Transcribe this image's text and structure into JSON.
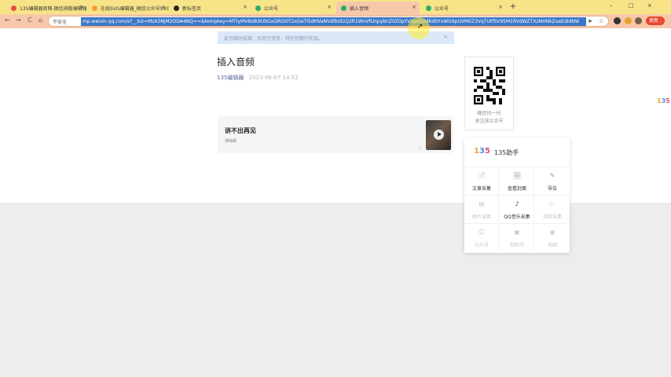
{
  "tabs": [
    {
      "title": "135编辑器官网-微信排版编辑器",
      "fav": "#e84b3c"
    },
    {
      "title": "在线SVG编辑器_微信公众号SVG",
      "fav": "#f0a030"
    },
    {
      "title": "新标签页",
      "fav": "#222222"
    },
    {
      "title": "公众号",
      "fav": "#2aae67"
    },
    {
      "title": "插入音频",
      "fav": "#2aae67"
    },
    {
      "title": "公众号",
      "fav": "#2aae67"
    }
  ],
  "tab_close": "×",
  "new_tab": "+",
  "window_controls": {
    "minimize": "–",
    "maximize": "□",
    "close": "×"
  },
  "nav": {
    "back": "←",
    "forward": "→",
    "reload": "C",
    "home": "⌂"
  },
  "address": {
    "security": "不安全",
    "url": "mp.weixin.qq.com/s?__biz=MzA3NjM2ODA4NQ==&tempkey=MTIyMV8idk9UbGxGRGl0T2xGeTI5dHVaNVdlbUtzQ2R1WnVfUnpybnZ0Z0pYVXpvSXdKd0YxWG9pUVM0Z3VqTUtfSV95M1RVdWZTXzNHNkZueEdIdkNl"
  },
  "update_label": "更新 :",
  "warning_bar": {
    "text": "此为临时链接，仅用于预览，将在短期内失效。",
    "close": "×"
  },
  "article": {
    "title": "插入音频",
    "author": "135编辑器",
    "date": "2023-06-07 14:52"
  },
  "audio": {
    "name": "讲不出再见",
    "source": "谭咏麟",
    "info": "ⓘ"
  },
  "qr": {
    "line1": "微信扫一扫",
    "line2": "关注该公众号"
  },
  "helper": {
    "logo": "135",
    "title": "135助手",
    "items": [
      {
        "icon": "📄",
        "label": "文章采集",
        "enabled": true
      },
      {
        "icon": "🖼",
        "label": "查看封面",
        "enabled": true
      },
      {
        "icon": "✎",
        "label": "导告",
        "enabled": true
      },
      {
        "icon": "▤",
        "label": "图片采集",
        "enabled": false
      },
      {
        "icon": "♪",
        "label": "QQ音乐采集",
        "enabled": true
      },
      {
        "icon": "▷",
        "label": "视频采集",
        "enabled": false
      },
      {
        "icon": "☺",
        "label": "公众号",
        "enabled": false
      },
      {
        "icon": "▣",
        "label": "视频号",
        "enabled": false
      },
      {
        "icon": "◉",
        "label": "地图",
        "enabled": false
      }
    ]
  },
  "side_badge": "135",
  "colors": {
    "tab_bar": "#f7e489",
    "active_tab": "#f6c8a9",
    "url_highlight": "#3c77c7",
    "link": "#576b95",
    "update": "#e9452f"
  }
}
